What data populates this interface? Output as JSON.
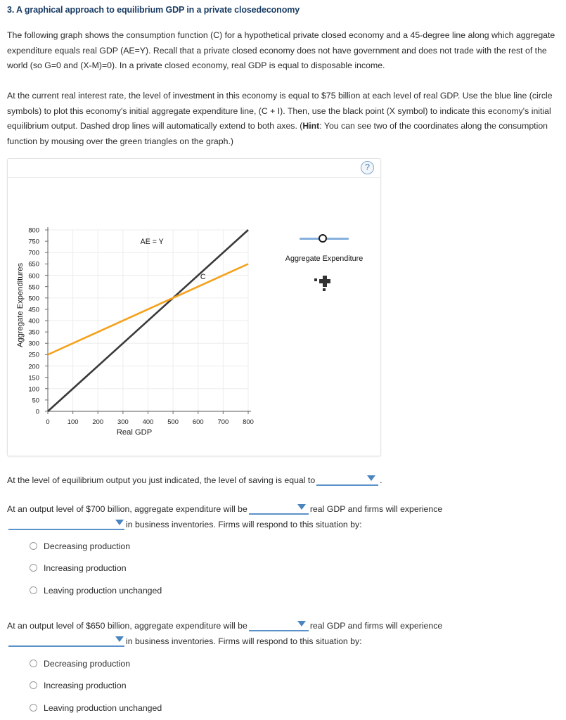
{
  "question": {
    "number_title": "3. A graphical approach to equilibrium GDP in a private closedeconomy",
    "paragraph_1": "The following graph shows the consumption function (C) for a hypothetical private closed economy and a 45-degree line along which aggregate expenditure equals real GDP (AE=Y). Recall that a private closed economy does not have government and does not trade with the rest of the world (so G=0 and (X-M)=0). In a private closed economy, real GDP is equal to disposable income.",
    "paragraph_2_part1": "At the current real interest rate, the level of investment in this economy is equal to $75 billion at each level of real GDP. Use the blue line (circle symbols) to plot this economy's initial aggregate expenditure line, (C + I). Then, use the black point (X symbol) to indicate this economy's initial equilibrium output. Dashed drop lines will automatically extend to both axes. (",
    "paragraph_2_hint_label": "Hint",
    "paragraph_2_part2": ": You can see two of the coordinates along the consumption function by mousing over the green triangles on the graph.)"
  },
  "graph_panel": {
    "help_icon_label": "?"
  },
  "legend": {
    "caption": "Aggregate Expenditure",
    "line_color": "#85b0dd",
    "symbol": "circle",
    "point_tool_name": "black-x-point-tool",
    "point_tool_color": "#333333"
  },
  "chart_data": {
    "type": "line",
    "title": "",
    "xlabel": "Real GDP",
    "ylabel": "Aggregate Expenditures",
    "xlim": [
      0,
      800
    ],
    "ylim": [
      0,
      800
    ],
    "xticks": [
      0,
      100,
      200,
      300,
      400,
      500,
      600,
      700,
      800
    ],
    "yticks": [
      0,
      50,
      100,
      150,
      200,
      250,
      300,
      350,
      400,
      450,
      500,
      550,
      600,
      650,
      700,
      750,
      800
    ],
    "grid": true,
    "legend_position": "right",
    "series": [
      {
        "name": "AE = Y",
        "label": "AE = Y",
        "color": "#3a3a3a",
        "x": [
          0,
          800
        ],
        "values": [
          0,
          800
        ],
        "label_x": 420,
        "label_y": 745
      },
      {
        "name": "C",
        "label": "C",
        "color": "#f5a11b",
        "x": [
          0,
          800
        ],
        "values": [
          250,
          650
        ],
        "label_x": 620,
        "label_y": 588
      }
    ],
    "intersection": {
      "x": 500,
      "y": 500
    }
  },
  "questions": [
    {
      "id": "saving",
      "text_before": "At the level of equilibrium output you just indicated, the level of saving is equal to",
      "dropdown_value": "",
      "text_after": "."
    },
    {
      "id": "output-700",
      "line1_before": "At an output level of $700 billion, aggregate expenditure will be",
      "line1_dropdown_value": "",
      "line1_after": "real GDP and firms will experience",
      "line2_dropdown_value": "",
      "line2_after": "in business inventories. Firms will respond to this situation by:",
      "options": [
        "Decreasing production",
        "Increasing production",
        "Leaving production unchanged"
      ]
    },
    {
      "id": "output-650",
      "line1_before": "At an output level of $650 billion, aggregate expenditure will be",
      "line1_dropdown_value": "",
      "line1_after": "real GDP and firms will experience",
      "line2_dropdown_value": "",
      "line2_after": "in business inventories. Firms will respond to this situation by:",
      "options": [
        "Decreasing production",
        "Increasing production",
        "Leaving production unchanged"
      ]
    }
  ],
  "colors": {
    "title": "#1a3c63",
    "accent_blue": "#5b92c9",
    "consumption_line": "#f5a11b",
    "ae_line": "#3a3a3a"
  }
}
